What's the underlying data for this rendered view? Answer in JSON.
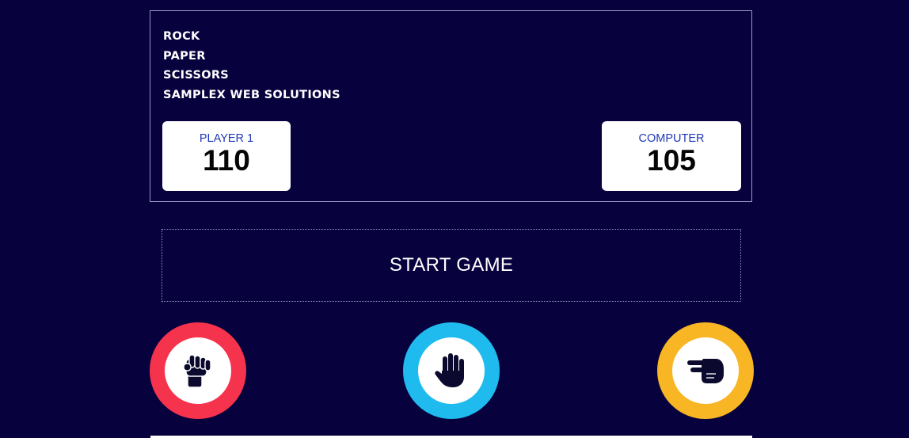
{
  "title_lines": [
    "ROCK",
    "PAPER",
    "SCISSORS",
    "SAMPLEX WEB SOLUTIONS"
  ],
  "player": {
    "label": "PLAYER 1",
    "score": "110"
  },
  "computer": {
    "label": "COMPUTER",
    "score": "105"
  },
  "start_button": {
    "label": "START GAME"
  },
  "choices": [
    {
      "name": "rock",
      "icon": "fist-icon",
      "ring_color": "#f5334c"
    },
    {
      "name": "paper",
      "icon": "open-hand-icon",
      "ring_color": "#1fbbef"
    },
    {
      "name": "scissors",
      "icon": "two-finger-hand-icon",
      "ring_color": "#f8b624"
    }
  ],
  "colors": {
    "background": "#07013d",
    "score_label": "#1f39b8",
    "icon": "#0b0a2e"
  }
}
